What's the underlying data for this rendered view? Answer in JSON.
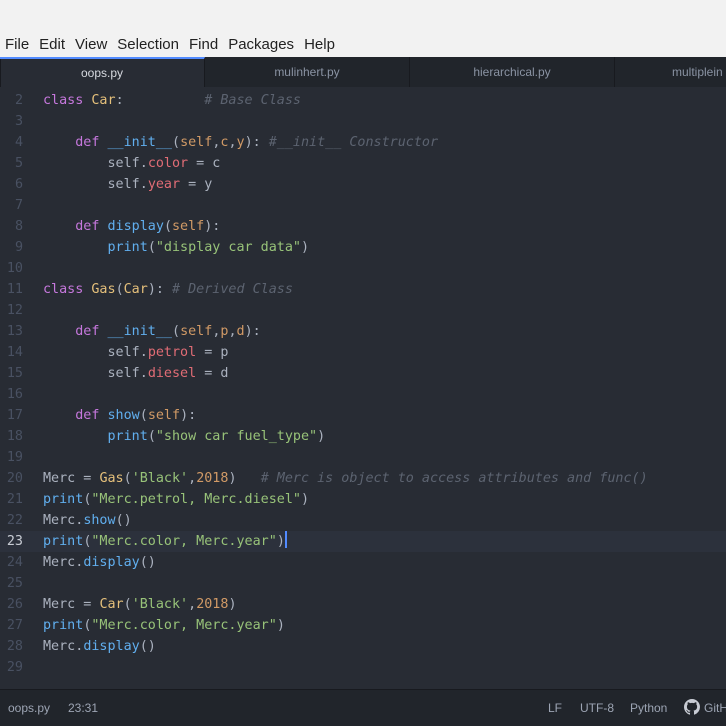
{
  "menubar": [
    "File",
    "Edit",
    "View",
    "Selection",
    "Find",
    "Packages",
    "Help"
  ],
  "tabs": [
    {
      "label": "oops.py",
      "active": true
    },
    {
      "label": "mulinhert.py",
      "active": false
    },
    {
      "label": "hierarchical.py",
      "active": false
    },
    {
      "label": "multiplein",
      "active": false
    }
  ],
  "editor": {
    "cursor_line": 23,
    "lines": [
      {
        "n": "2",
        "t": [
          [
            "kw",
            "class "
          ],
          [
            "cls",
            "Car"
          ],
          [
            "p",
            ":          "
          ],
          [
            "cmt",
            "# Base Class"
          ]
        ]
      },
      {
        "n": "3",
        "t": []
      },
      {
        "n": "4",
        "t": [
          [
            "p",
            "    "
          ],
          [
            "kw",
            "def "
          ],
          [
            "fn",
            "__init__"
          ],
          [
            "p",
            "("
          ],
          [
            "param",
            "self"
          ],
          [
            "p",
            ","
          ],
          [
            "param",
            "c"
          ],
          [
            "p",
            ","
          ],
          [
            "param",
            "y"
          ],
          [
            "p",
            "): "
          ],
          [
            "cmt",
            "#__init__ Constructor"
          ]
        ]
      },
      {
        "n": "5",
        "t": [
          [
            "p",
            "        self."
          ],
          [
            "prop",
            "color"
          ],
          [
            "p",
            " = c"
          ]
        ]
      },
      {
        "n": "6",
        "t": [
          [
            "p",
            "        self."
          ],
          [
            "prop",
            "year"
          ],
          [
            "p",
            " = y"
          ]
        ]
      },
      {
        "n": "7",
        "t": []
      },
      {
        "n": "8",
        "t": [
          [
            "p",
            "    "
          ],
          [
            "kw",
            "def "
          ],
          [
            "fn",
            "display"
          ],
          [
            "p",
            "("
          ],
          [
            "param",
            "self"
          ],
          [
            "p",
            "):"
          ]
        ]
      },
      {
        "n": "9",
        "t": [
          [
            "p",
            "        "
          ],
          [
            "fn",
            "print"
          ],
          [
            "p",
            "("
          ],
          [
            "str",
            "\"display car data\""
          ],
          [
            "p",
            ")"
          ]
        ]
      },
      {
        "n": "10",
        "t": []
      },
      {
        "n": "11",
        "t": [
          [
            "kw",
            "class "
          ],
          [
            "cls",
            "Gas"
          ],
          [
            "p",
            "("
          ],
          [
            "cls",
            "Car"
          ],
          [
            "p",
            "): "
          ],
          [
            "cmt",
            "# Derived Class"
          ]
        ]
      },
      {
        "n": "12",
        "t": []
      },
      {
        "n": "13",
        "t": [
          [
            "p",
            "    "
          ],
          [
            "kw",
            "def "
          ],
          [
            "fn",
            "__init__"
          ],
          [
            "p",
            "("
          ],
          [
            "param",
            "self"
          ],
          [
            "p",
            ","
          ],
          [
            "param",
            "p"
          ],
          [
            "p",
            ","
          ],
          [
            "param",
            "d"
          ],
          [
            "p",
            "):"
          ]
        ]
      },
      {
        "n": "14",
        "t": [
          [
            "p",
            "        self."
          ],
          [
            "prop",
            "petrol"
          ],
          [
            "p",
            " = p"
          ]
        ]
      },
      {
        "n": "15",
        "t": [
          [
            "p",
            "        self."
          ],
          [
            "prop",
            "diesel"
          ],
          [
            "p",
            " = d"
          ]
        ]
      },
      {
        "n": "16",
        "t": []
      },
      {
        "n": "17",
        "t": [
          [
            "p",
            "    "
          ],
          [
            "kw",
            "def "
          ],
          [
            "fn",
            "show"
          ],
          [
            "p",
            "("
          ],
          [
            "param",
            "self"
          ],
          [
            "p",
            "):"
          ]
        ]
      },
      {
        "n": "18",
        "t": [
          [
            "p",
            "        "
          ],
          [
            "fn",
            "print"
          ],
          [
            "p",
            "("
          ],
          [
            "str",
            "\"show car fuel_type\""
          ],
          [
            "p",
            ")"
          ]
        ]
      },
      {
        "n": "19",
        "t": []
      },
      {
        "n": "20",
        "t": [
          [
            "p",
            "Merc = "
          ],
          [
            "cls",
            "Gas"
          ],
          [
            "p",
            "("
          ],
          [
            "str",
            "'Black'"
          ],
          [
            "p",
            ","
          ],
          [
            "num",
            "2018"
          ],
          [
            "p",
            ")   "
          ],
          [
            "cmt",
            "# Merc is object to access attributes and func()"
          ]
        ]
      },
      {
        "n": "21",
        "t": [
          [
            "fn",
            "print"
          ],
          [
            "p",
            "("
          ],
          [
            "str",
            "\"Merc.petrol, Merc.diesel\""
          ],
          [
            "p",
            ")"
          ]
        ]
      },
      {
        "n": "22",
        "t": [
          [
            "p",
            "Merc."
          ],
          [
            "fn",
            "show"
          ],
          [
            "p",
            "()"
          ]
        ]
      },
      {
        "n": "23",
        "t": [
          [
            "fn",
            "print"
          ],
          [
            "p",
            "("
          ],
          [
            "str",
            "\"Merc.color, Merc.year\""
          ],
          [
            "p",
            ")"
          ]
        ]
      },
      {
        "n": "24",
        "t": [
          [
            "p",
            "Merc."
          ],
          [
            "fn",
            "display"
          ],
          [
            "p",
            "()"
          ]
        ]
      },
      {
        "n": "25",
        "t": []
      },
      {
        "n": "26",
        "t": [
          [
            "p",
            "Merc = "
          ],
          [
            "cls",
            "Car"
          ],
          [
            "p",
            "("
          ],
          [
            "str",
            "'Black'"
          ],
          [
            "p",
            ","
          ],
          [
            "num",
            "2018"
          ],
          [
            "p",
            ")"
          ]
        ]
      },
      {
        "n": "27",
        "t": [
          [
            "fn",
            "print"
          ],
          [
            "p",
            "("
          ],
          [
            "str",
            "\"Merc.color, Merc.year\""
          ],
          [
            "p",
            ")"
          ]
        ]
      },
      {
        "n": "28",
        "t": [
          [
            "p",
            "Merc."
          ],
          [
            "fn",
            "display"
          ],
          [
            "p",
            "()"
          ]
        ]
      },
      {
        "n": "29",
        "t": []
      }
    ]
  },
  "statusbar": {
    "file": "oops.py",
    "position": "23:31",
    "line_ending": "LF",
    "encoding": "UTF-8",
    "grammar": "Python",
    "github": "GitH"
  }
}
